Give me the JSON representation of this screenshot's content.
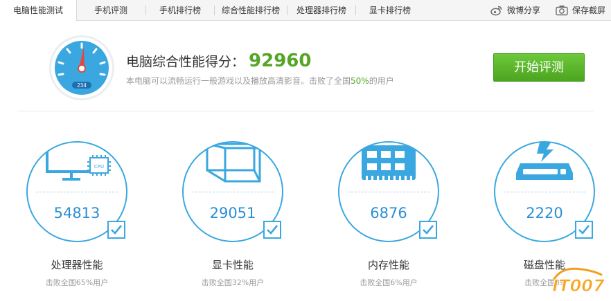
{
  "tabs": [
    {
      "label": "电脑性能测试",
      "active": true
    },
    {
      "label": "手机评测"
    },
    {
      "label": "手机排行榜"
    },
    {
      "label": "综合性能排行榜"
    },
    {
      "label": "处理器排行榜"
    },
    {
      "label": "显卡排行榜"
    }
  ],
  "toolbar": {
    "share_label": "微博分享",
    "save_label": "保存截屏",
    "share_icon": "weibo-icon",
    "save_icon": "camera-icon"
  },
  "summary": {
    "gauge_display": "234",
    "score_label": "电脑综合性能得分：",
    "score_value": "92960",
    "sub_prefix": "本电脑可以流畅运行一般游戏以及播放高清影音。击败了全国",
    "sub_pct": "50%",
    "sub_suffix": "的用户",
    "start_button": "开始评测"
  },
  "cards": [
    {
      "value": "54813",
      "title": "处理器性能",
      "sub": "击败全国65%用户",
      "icon": "cpu-monitor-icon"
    },
    {
      "value": "29051",
      "title": "显卡性能",
      "sub": "击败全国32%用户",
      "icon": "gpu-cube-icon"
    },
    {
      "value": "6876",
      "title": "内存性能",
      "sub": "击败全国6%用户",
      "icon": "memory-icon"
    },
    {
      "value": "2220",
      "title": "磁盘性能",
      "sub": "击败全国39",
      "icon": "disk-icon"
    }
  ],
  "watermark": "IT007",
  "colors": {
    "accent_green": "#55a526",
    "accent_blue": "#3aa7e0",
    "number_blue": "#2b8fd4"
  }
}
